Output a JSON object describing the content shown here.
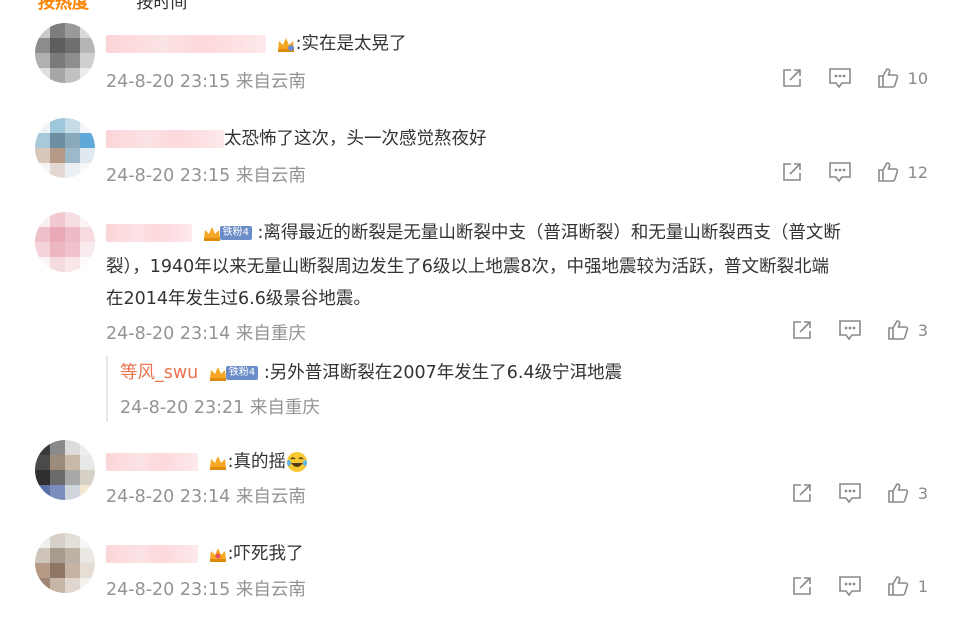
{
  "tabs": {
    "hot": "按热度",
    "time": "按时间"
  },
  "comments": [
    {
      "text": ":实在是太晃了",
      "time": "24-8-20 23:15",
      "location": "来自云南",
      "likes": "10"
    },
    {
      "text": "太恐怖了这次，头一次感觉熬夜好",
      "time": "24-8-20 23:15",
      "location": "来自云南",
      "likes": "12"
    },
    {
      "fan_badge": "铁粉4",
      "text_line1": ":离得最近的断裂是无量山断裂中支（普洱断裂）和无量山断裂西支（普文断",
      "text_line2": "裂），1940年以来无量山断裂周边发生了6级以上地震8次，中强地震较为活跃，普文断裂北端",
      "text_line3": "在2014年发生过6.6级景谷地震。",
      "time": "24-8-20 23:14",
      "location": "来自重庆",
      "likes": "3",
      "reply": {
        "author": "等风_swu",
        "fan_badge": "铁粉4",
        "text": ":另外普洱断裂在2007年发生了6.4级宁洱地震",
        "time": "24-8-20 23:21",
        "location": "来自重庆"
      }
    },
    {
      "text": ":真的摇",
      "time": "24-8-20 23:14",
      "location": "来自云南",
      "likes": "3"
    },
    {
      "text": ":吓死我了",
      "time": "24-8-20 23:15",
      "location": "来自云南",
      "likes": "1"
    }
  ],
  "icons": {
    "share": "share-icon",
    "comment": "comment-icon",
    "like": "like-icon",
    "crown": "crown-badge-icon",
    "emoji": "laugh-cry-emoji-icon"
  },
  "colors": {
    "accent": "#ff8200",
    "reply_author": "#eb7350",
    "meta": "#939393",
    "fan_badge": "#6b8ec8"
  }
}
